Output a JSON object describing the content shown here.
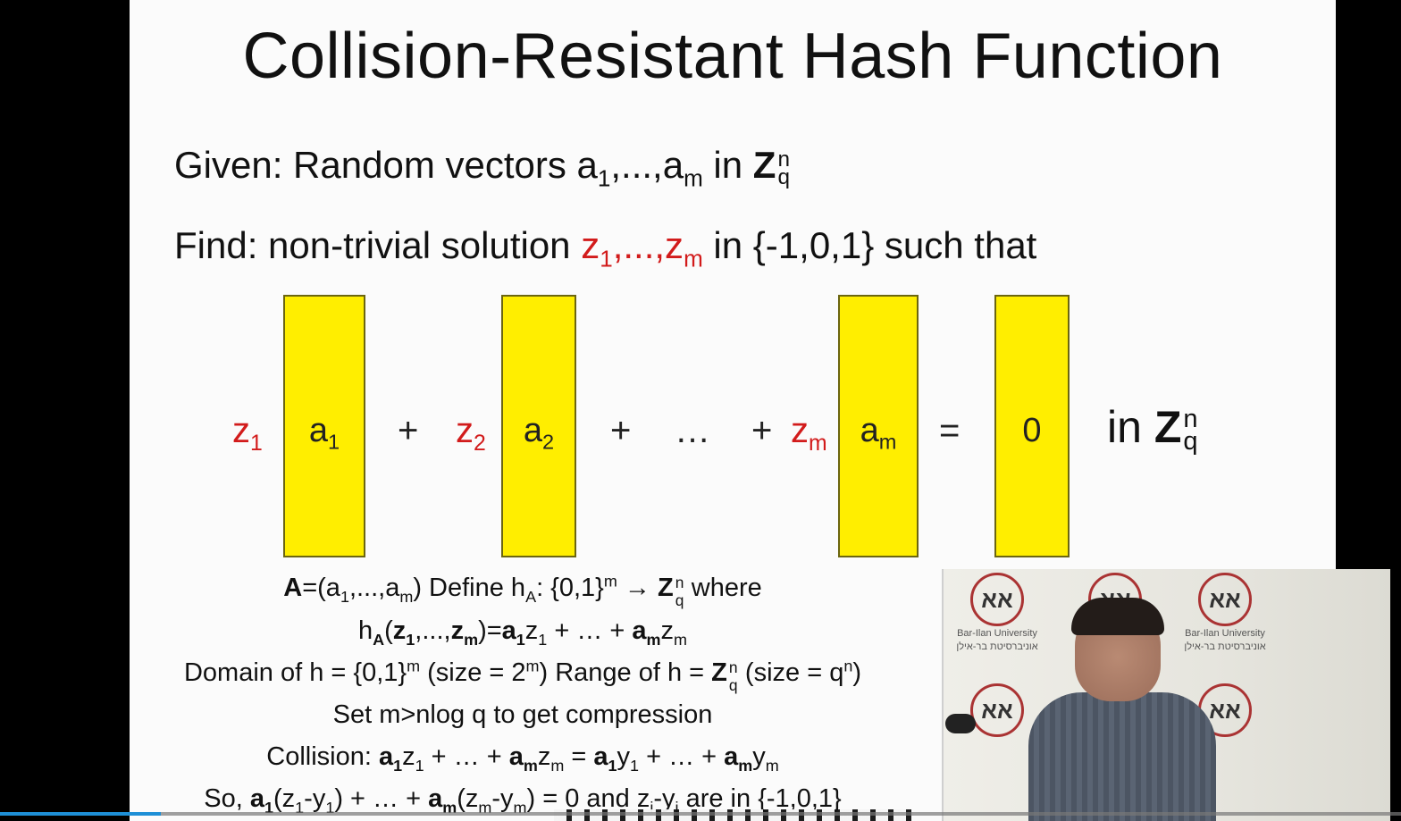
{
  "slide": {
    "title": "Collision-Resistant Hash Function",
    "given": {
      "prefix": "Given: Random vectors a",
      "sub1": "1",
      "mid": ",...,a",
      "subm": "m",
      "suffix": " in ",
      "Z": "Z",
      "sup_n": "n",
      "sub_q": "q"
    },
    "find": {
      "prefix": "Find: non-trivial solution ",
      "z1": "z",
      "sub1": "1",
      "dots": ",...,z",
      "subm": "m",
      "suffix": " in {-1,0,1} such that"
    },
    "equation": {
      "coef1": "z",
      "coef1_sub": "1",
      "bar1": "a",
      "bar1_sub": "1",
      "plus1": "+",
      "coef2": "z",
      "coef2_sub": "2",
      "bar2": "a",
      "bar2_sub": "2",
      "plus2": "+",
      "ellipsis": "…",
      "plus3": "+",
      "coefm": "z",
      "coefm_sub": "m",
      "barm": "a",
      "barm_sub": "m",
      "equals": "=",
      "bar0": "0",
      "in": "in ",
      "Z": "Z",
      "sup_n": "n",
      "sub_q": "q"
    },
    "lines": {
      "line1_A": "A",
      "line1_rest": "=(a",
      "line1_sub1": "1",
      "line1_mid": ",...,a",
      "line1_subm": "m",
      "line1_close": ")   Define h",
      "line1_subA": "A",
      "line1_domain": ": {0,1}",
      "line1_sup_m": "m",
      "line1_arrow": " → ",
      "line1_Z": "Z",
      "line1_sup_n": "n",
      "line1_sub_q": "q",
      "line1_where": " where",
      "line2": "h",
      "line2_subA": "A",
      "line2_open": "(",
      "line2_z": "z",
      "line2_sub1": "1",
      "line2_dots": ",...,",
      "line2_zm": "z",
      "line2_subm": "m",
      "line2_eq": ")=",
      "line2_a1": "a",
      "line2_a1sub": "1",
      "line2_z1": "z",
      "line2_z1sub": "1",
      "line2_plus": " + … + ",
      "line2_am": "a",
      "line2_amsub": "m",
      "line2_zm2": "z",
      "line2_zm2sub": "m",
      "line3_a": "Domain of h = {0,1}",
      "line3_sup_m": "m",
      "line3_b": "  (size = 2",
      "line3_sup_m2": "m",
      "line3_c": ")  Range of h = ",
      "line3_Z": "Z",
      "line3_sup_n": "n",
      "line3_sub_q": "q",
      "line3_d": " (size = q",
      "line3_sup_n2": "n",
      "line3_e": ")",
      "line4": "Set m>nlog q to get compression",
      "line5_a": "Collision: ",
      "line5_b": "a",
      "line5_b_sub": "1",
      "line5_c": "z",
      "line5_c_sub": "1",
      "line5_d": " + … + ",
      "line5_e": "a",
      "line5_e_sub": "m",
      "line5_f": "z",
      "line5_f_sub": "m",
      "line5_g": " = ",
      "line5_h": "a",
      "line5_h_sub": "1",
      "line5_i": "y",
      "line5_i_sub": "1",
      "line5_j": " + … + ",
      "line5_k": "a",
      "line5_k_sub": "m",
      "line5_l": "y",
      "line5_l_sub": "m",
      "line6_a": "So, ",
      "line6_b": "a",
      "line6_b_sub": "1",
      "line6_c": "(z",
      "line6_c_sub": "1",
      "line6_d": "-y",
      "line6_d_sub": "1",
      "line6_e": ") + … + ",
      "line6_f": "a",
      "line6_f_sub": "m",
      "line6_g": "(z",
      "line6_g_sub": "m",
      "line6_h": "-y",
      "line6_h_sub": "m",
      "line6_i": ") = 0 and z",
      "line6_i_sub": "i",
      "line6_j": "-y",
      "line6_j_sub": "i",
      "line6_k": " are in {-1,0,1}"
    }
  },
  "pip": {
    "logo_mark": "אא",
    "logo_name": "Bar-Ilan University",
    "logo_hebrew": "אוניברסיטת בר-אילן"
  },
  "player": {
    "progress_fraction": 0.115
  },
  "colors": {
    "bar_fill": "#ffee00",
    "coef_red": "#d21b1b",
    "progress": "#1e8fd6"
  }
}
